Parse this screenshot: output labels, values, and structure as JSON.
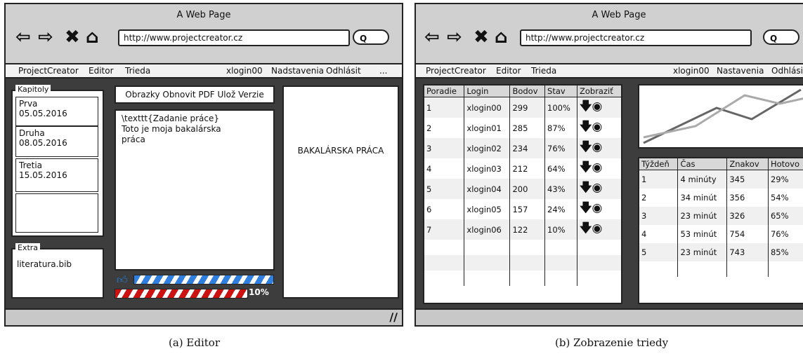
{
  "left": {
    "window_title": "A Web Page",
    "url": "http://www.projectcreator.cz",
    "menu": {
      "app": "ProjectCreator",
      "editor": "Editor",
      "trieda": "Trieda",
      "user": "xlogin00",
      "settings": "Nadstavenia",
      "logout": "Odhlásit",
      "more": "..."
    },
    "chapters": {
      "legend": "Kapitoly",
      "items": [
        {
          "name": "Prva",
          "date": "05.05.2016"
        },
        {
          "name": "Druha",
          "date": "08.05.2016"
        },
        {
          "name": "Tretia",
          "date": "15.05.2016"
        }
      ]
    },
    "extra": {
      "legend": "Extra",
      "file": "literatura.bib"
    },
    "toolbar": "Obrazky Obnovit PDF Ulož Verzie",
    "editor_lines": [
      "\\texttt{Zadanie práce}",
      "Toto je moja bakalárska",
      "práca"
    ],
    "preview": "BAKALÁRSKA PRÁCA",
    "progress_main": 1.0,
    "progress_red": 0.1,
    "progress_label": "10%",
    "caption": "(a) Editor"
  },
  "right": {
    "window_title": "A Web Page",
    "url": "http://www.projectcreator.cz",
    "menu": {
      "app": "ProjectCreator",
      "editor": "Editor",
      "trieda": "Trieda",
      "user": "xlogin00",
      "settings": "Nastavenia",
      "logout": "Odhlásit"
    },
    "students": {
      "headers": [
        "Poradie",
        "Login",
        "Bodov",
        "Stav",
        "Zobraziť"
      ],
      "rows": [
        [
          "1",
          "xlogin00",
          "299",
          "100%"
        ],
        [
          "2",
          "xlogin01",
          "285",
          "87%"
        ],
        [
          "3",
          "xlogin02",
          "234",
          "76%"
        ],
        [
          "4",
          "xlogin03",
          "212",
          "64%"
        ],
        [
          "5",
          "xlogin04",
          "200",
          "43%"
        ],
        [
          "6",
          "xlogin05",
          "157",
          "24%"
        ],
        [
          "7",
          "xlogin06",
          "122",
          "10%"
        ]
      ]
    },
    "weeks": {
      "headers": [
        "Týždeň",
        "Čas",
        "Znakov",
        "Hotovo"
      ],
      "rows": [
        [
          "1",
          "4 minúty",
          "345",
          "29%"
        ],
        [
          "2",
          "34 minút",
          "356",
          "54%"
        ],
        [
          "3",
          "23 minút",
          "326",
          "65%"
        ],
        [
          "4",
          "53 minút",
          "754",
          "76%"
        ],
        [
          "5",
          "23 minút",
          "743",
          "85%"
        ]
      ]
    },
    "caption": "(b) Zobrazenie triedy"
  }
}
